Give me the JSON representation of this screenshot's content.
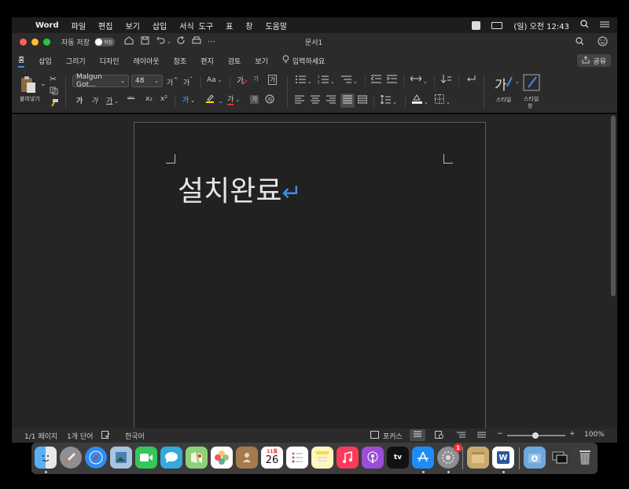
{
  "menubar": {
    "app_name": "Word",
    "items": [
      "파일",
      "편집",
      "보기",
      "삽입",
      "서식",
      "도구",
      "표",
      "창",
      "도움말"
    ],
    "clock": "(일) 오전 12:43"
  },
  "titlebar": {
    "autosave_label": "자동 저장",
    "autosave_toggle": "꺼짐",
    "title": "문서1"
  },
  "ribbon_tabs": [
    "홈",
    "삽입",
    "그리기",
    "디자인",
    "레이아웃",
    "참조",
    "편지",
    "검토",
    "보기"
  ],
  "ribbon": {
    "tell_me": "입력하세요",
    "share": "공유",
    "paste_label": "붙여넣기",
    "font_name": "Malgun Got...",
    "font_size": "48",
    "font_grow": "가",
    "font_shrink": "가",
    "change_case": "Aa",
    "bold": "가",
    "italic": "가",
    "underline": "가",
    "strike": "ᵃᵇᶜ",
    "sub": "x₂",
    "sup": "x²",
    "phonetic": "가",
    "char_border": "가",
    "font_color": "가",
    "char_shade": "가",
    "styles_glyph": "가",
    "styles_label": "스타일",
    "styles_pane_label_1": "스타일",
    "styles_pane_label_2": "창"
  },
  "document": {
    "text": "설치완료",
    "paragraph_mark": "↵"
  },
  "statusbar": {
    "page": "1/1 페이지",
    "words": "1개 단어",
    "language": "한국어",
    "focus": "포커스",
    "zoom": "100%",
    "zoom_minus": "−",
    "zoom_plus": "+"
  },
  "dock": {
    "calendar_month": "11월",
    "calendar_day": "26",
    "appletv_label": "tv",
    "settings_badge": "1",
    "word_letter": "W"
  },
  "colors": {
    "accent": "#3b8eea",
    "highlight_yellow": "#f5e000",
    "font_red": "#e03030"
  }
}
